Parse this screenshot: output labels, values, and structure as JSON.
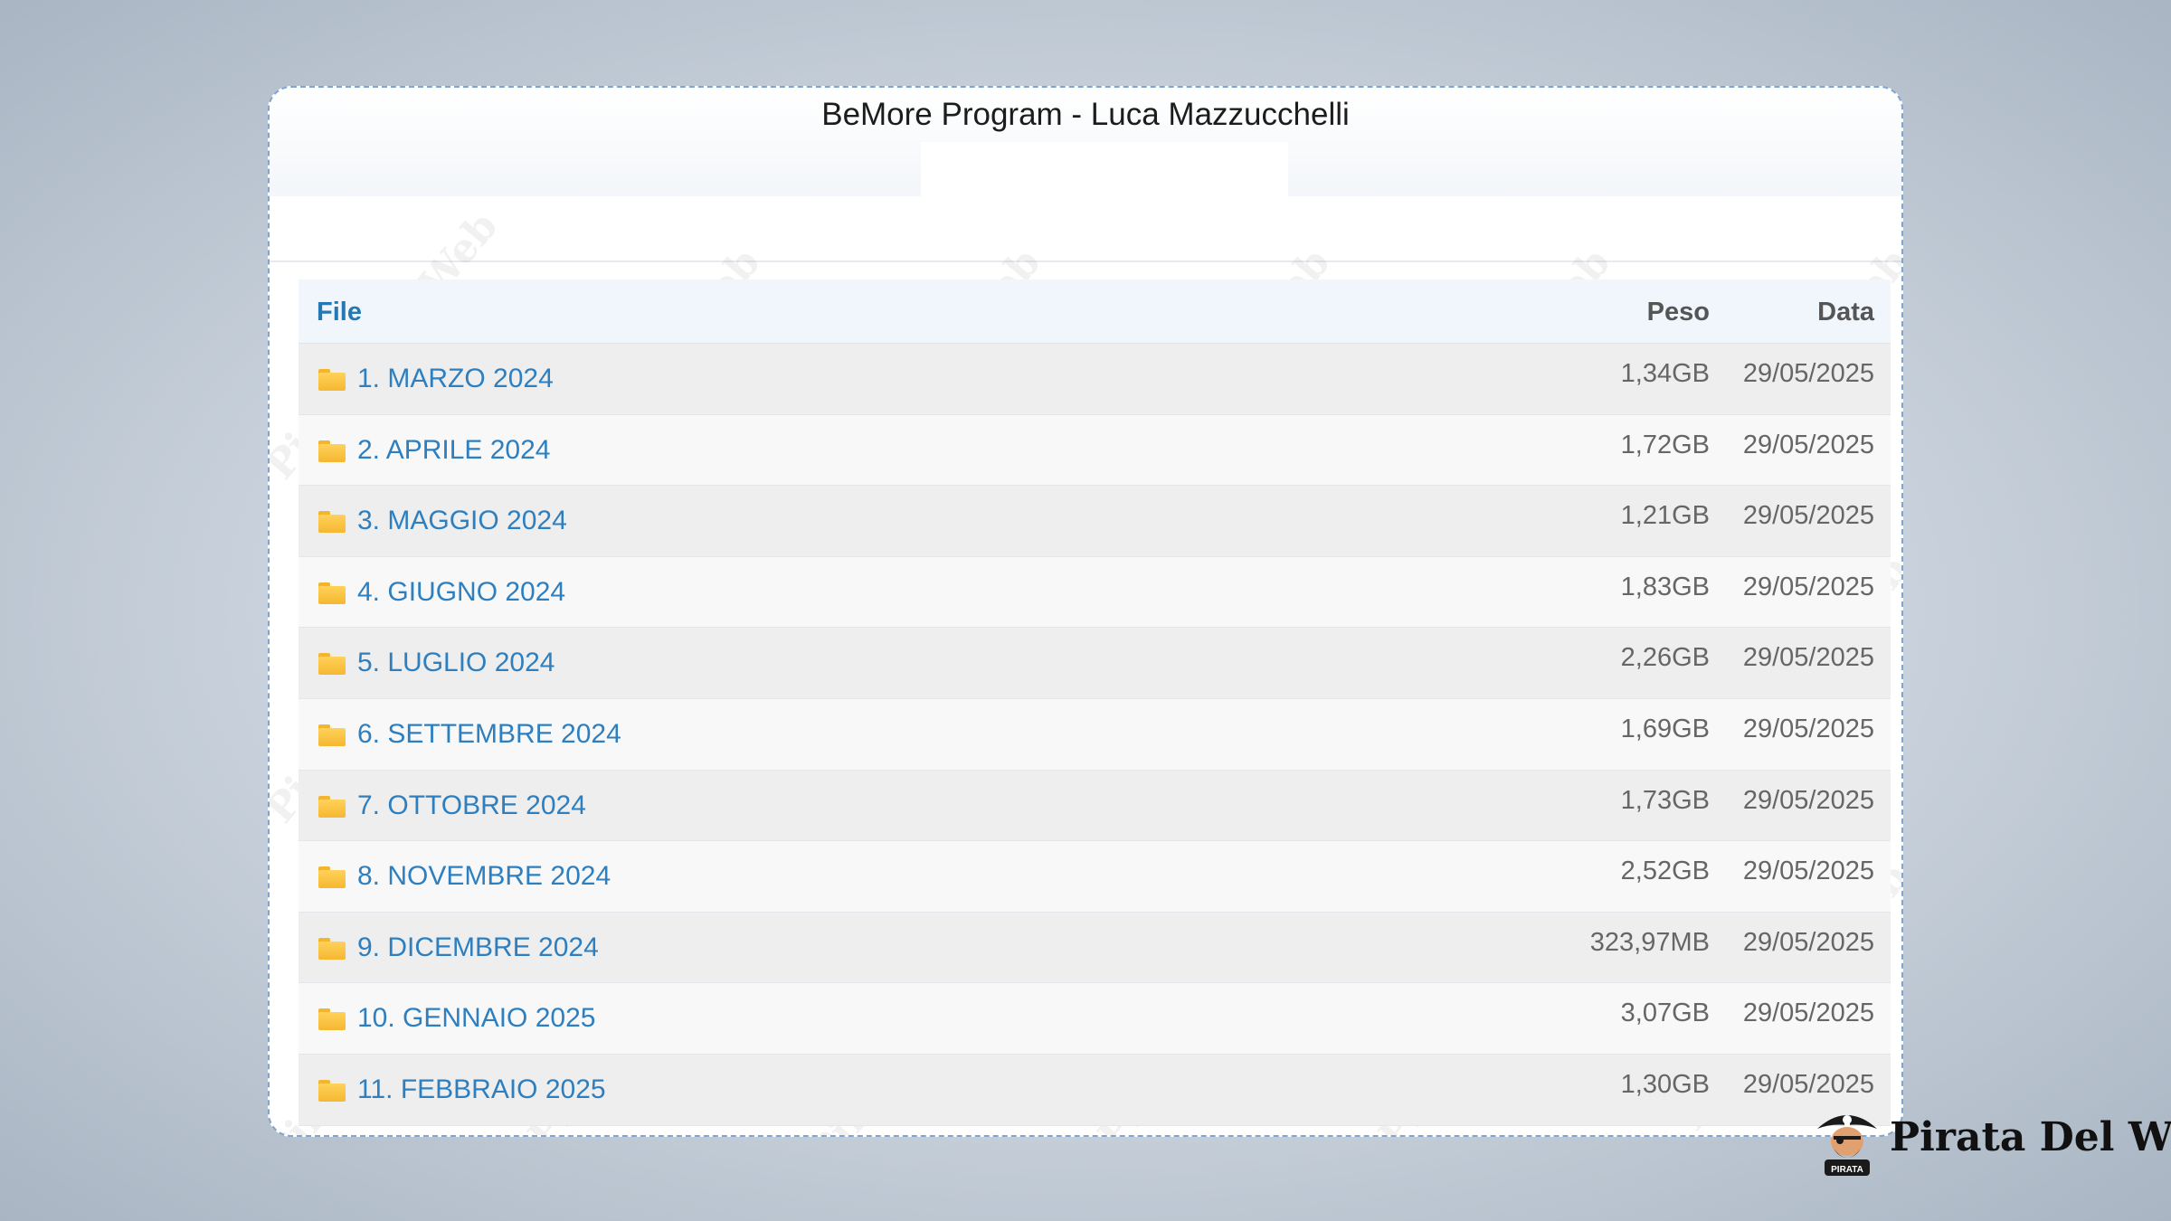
{
  "window": {
    "title": "BeMore Program - Luca Mazzucchelli"
  },
  "table": {
    "headers": {
      "file": "File",
      "peso": "Peso",
      "data": "Data"
    },
    "rows": [
      {
        "name": "1. MARZO 2024",
        "size": "1,34GB",
        "date": "29/05/2025",
        "icon": "folder-icon"
      },
      {
        "name": "2. APRILE 2024",
        "size": "1,72GB",
        "date": "29/05/2025",
        "icon": "folder-icon"
      },
      {
        "name": "3. MAGGIO 2024",
        "size": "1,21GB",
        "date": "29/05/2025",
        "icon": "folder-icon"
      },
      {
        "name": "4. GIUGNO 2024",
        "size": "1,83GB",
        "date": "29/05/2025",
        "icon": "folder-icon"
      },
      {
        "name": "5. LUGLIO 2024",
        "size": "2,26GB",
        "date": "29/05/2025",
        "icon": "folder-icon"
      },
      {
        "name": "6. SETTEMBRE 2024",
        "size": "1,69GB",
        "date": "29/05/2025",
        "icon": "folder-icon"
      },
      {
        "name": "7. OTTOBRE 2024",
        "size": "1,73GB",
        "date": "29/05/2025",
        "icon": "folder-icon"
      },
      {
        "name": "8. NOVEMBRE 2024",
        "size": "2,52GB",
        "date": "29/05/2025",
        "icon": "folder-icon"
      },
      {
        "name": "9. DICEMBRE 2024",
        "size": "323,97MB",
        "date": "29/05/2025",
        "icon": "folder-icon"
      },
      {
        "name": "10. GENNAIO 2025",
        "size": "3,07GB",
        "date": "29/05/2025",
        "icon": "folder-icon"
      },
      {
        "name": "11. FEBBRAIO 2025",
        "size": "1,30GB",
        "date": "29/05/2025",
        "icon": "folder-icon"
      }
    ]
  },
  "watermark": {
    "text": "Pirata Del Web"
  },
  "brand": {
    "name": "Pirata Del Web",
    "avatar_label": "PIRATA",
    "icon": "pirate-logo-icon"
  },
  "colors": {
    "link": "#2d7fc0",
    "header_link": "#2478b5",
    "folder": "#f5b731",
    "row_odd": "#eeeeee",
    "row_even": "#f8f8f8",
    "header_bg": "#f1f5fc"
  }
}
